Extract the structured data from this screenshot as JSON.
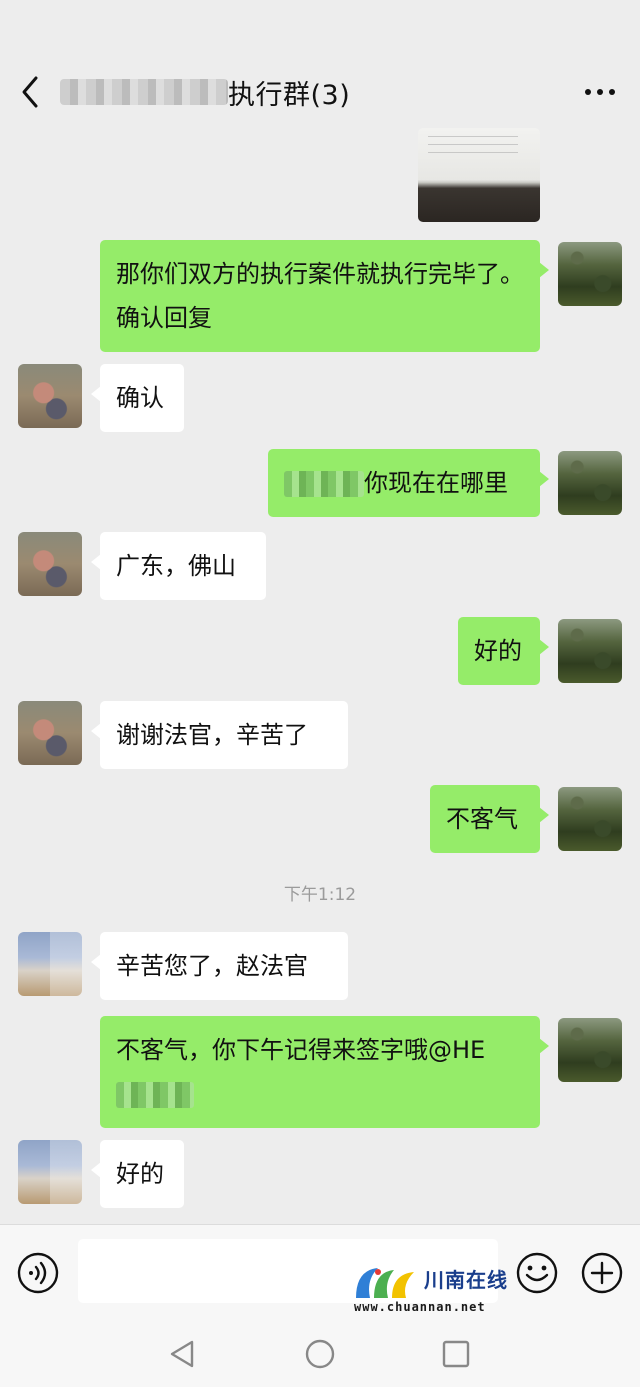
{
  "header": {
    "title": "执行群(3)"
  },
  "messages": [
    {
      "side": "me",
      "type": "image"
    },
    {
      "side": "me",
      "type": "text",
      "text": "那你们双方的执行案件就执行完毕了。确认回复"
    },
    {
      "side": "other",
      "type": "text",
      "text": "确认"
    },
    {
      "side": "me",
      "type": "text",
      "text": "你现在在哪里"
    },
    {
      "side": "other",
      "type": "text",
      "text": "广东，佛山"
    },
    {
      "side": "me",
      "type": "text",
      "text": "好的"
    },
    {
      "side": "other",
      "type": "text",
      "text": "谢谢法官，辛苦了"
    },
    {
      "side": "me",
      "type": "text",
      "text": "不客气"
    },
    {
      "type": "timestamp",
      "text": "下午1:12"
    },
    {
      "side": "other",
      "type": "text",
      "text": "辛苦您了，赵法官"
    },
    {
      "side": "me",
      "type": "text",
      "text": "不客气，你下午记得来签字哦@HE"
    },
    {
      "side": "other",
      "type": "text",
      "text": "好的"
    }
  ],
  "watermark": {
    "name": "川南在线",
    "url": "www.chuannan.net"
  }
}
